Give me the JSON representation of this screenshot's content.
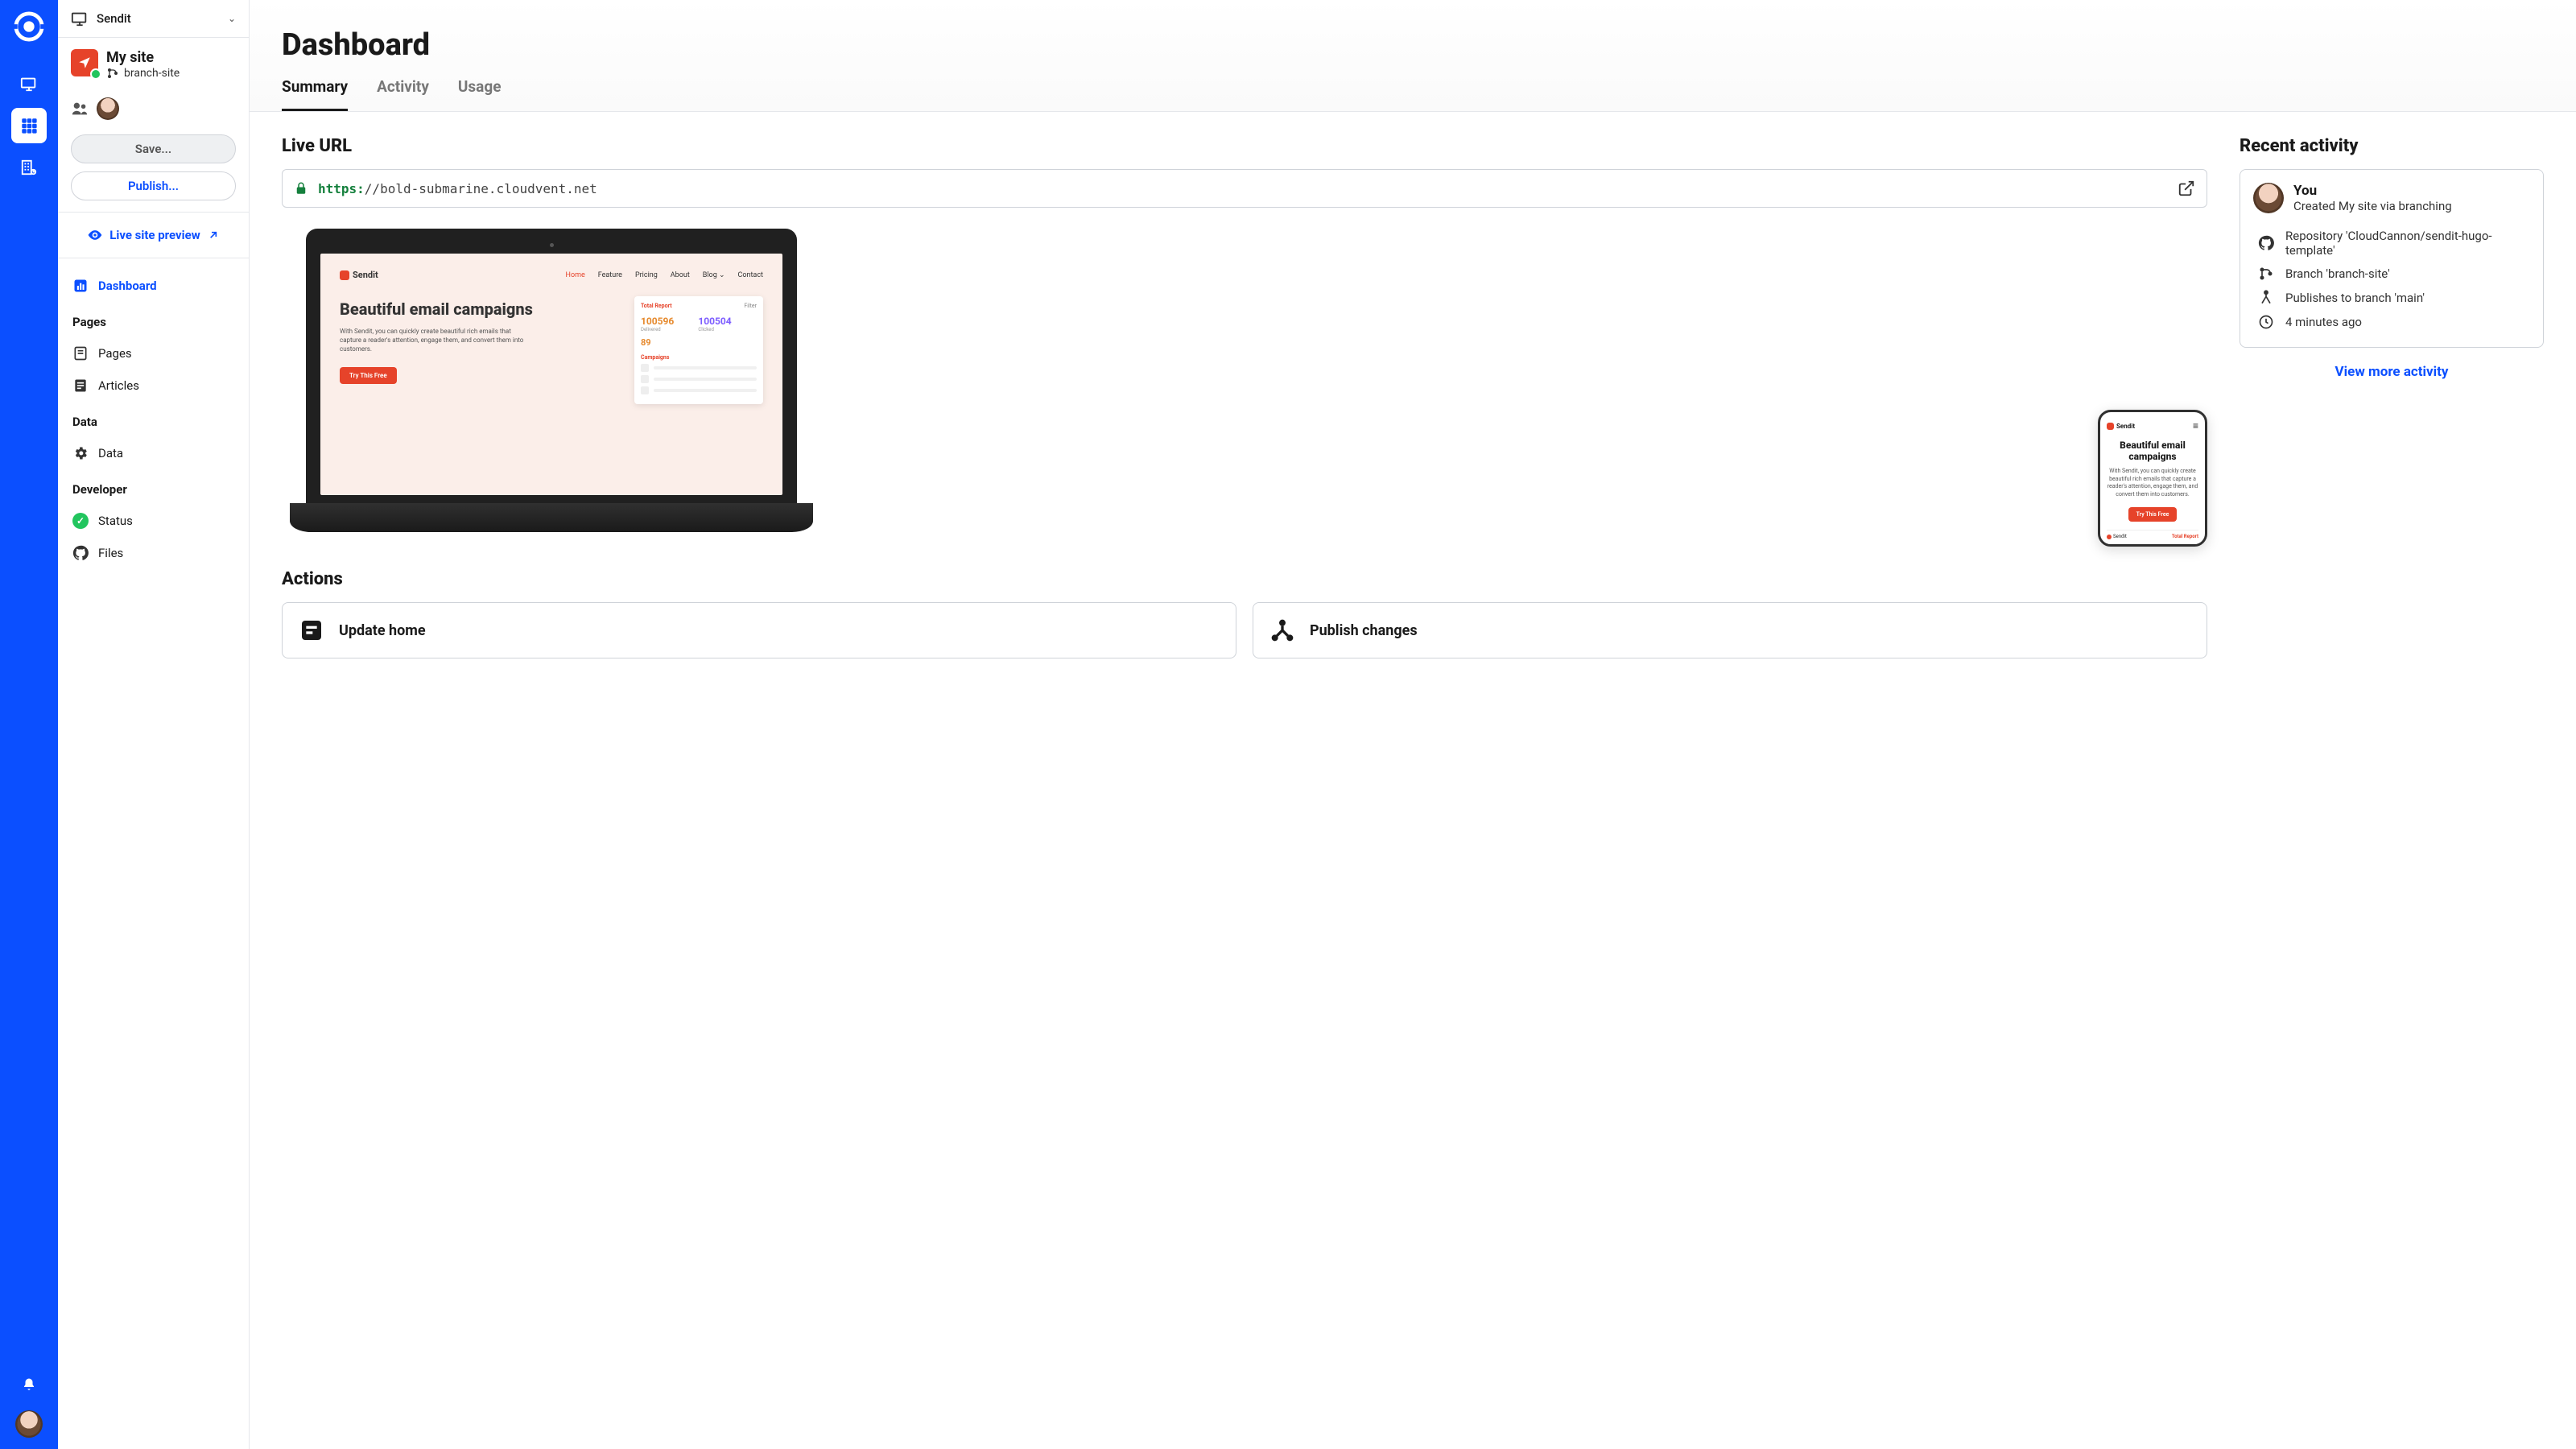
{
  "rail": {
    "items": [
      "logo",
      "site",
      "apps",
      "org"
    ]
  },
  "switcher": {
    "site_name": "Sendit"
  },
  "site": {
    "name": "My site",
    "branch": "branch-site"
  },
  "buttons": {
    "save": "Save...",
    "publish": "Publish..."
  },
  "preview_link": "Live site preview",
  "nav": {
    "dashboard": "Dashboard",
    "section_pages": "Pages",
    "pages": "Pages",
    "articles": "Articles",
    "section_data": "Data",
    "data": "Data",
    "section_dev": "Developer",
    "status": "Status",
    "files": "Files"
  },
  "page": {
    "title": "Dashboard",
    "tabs": {
      "summary": "Summary",
      "activity": "Activity",
      "usage": "Usage"
    }
  },
  "live_url": {
    "heading": "Live URL",
    "scheme": "https:",
    "rest": "//bold-submarine.cloudvent.net"
  },
  "mock": {
    "brand": "Sendit",
    "links": [
      "Home",
      "Feature",
      "Pricing",
      "About",
      "Blog ⌄",
      "Contact"
    ],
    "h1": "Beautiful email campaigns",
    "p": "With Sendit, you can quickly create beautiful rich emails that capture a reader's attention, engage them, and convert them into customers.",
    "cta": "Try This Free",
    "panel_title": "Total Report",
    "panel_filter": "Filter",
    "stat_a": "100596",
    "stat_a_l": "Delivered",
    "stat_b": "100504",
    "stat_b_l": "Clicked",
    "stat_c": "89",
    "campaigns": "Campaigns"
  },
  "actions": {
    "heading": "Actions",
    "update_home": "Update home",
    "publish_changes": "Publish changes"
  },
  "recent": {
    "heading": "Recent activity",
    "you": "You",
    "created": "Created My site via branching",
    "repo": "Repository 'CloudCannon/sendit-hugo-template'",
    "branch": "Branch 'branch-site'",
    "publishes": "Publishes to branch 'main'",
    "time": "4 minutes ago",
    "view_more": "View more activity"
  }
}
